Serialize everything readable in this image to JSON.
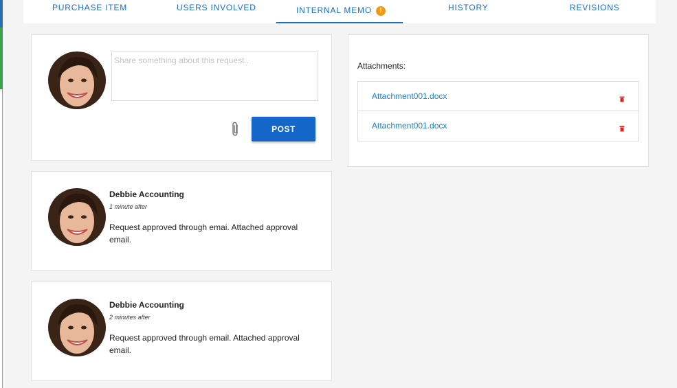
{
  "tabs": [
    {
      "label": "PURCHASE ITEM"
    },
    {
      "label": "USERS INVOLVED"
    },
    {
      "label": "INTERNAL MEMO",
      "badge": "!"
    },
    {
      "label": "HISTORY"
    },
    {
      "label": "REVISIONS"
    }
  ],
  "active_tab": "INTERNAL MEMO",
  "composer": {
    "placeholder": "Share something about this request..",
    "value": "",
    "post_label": "POST",
    "attach_icon": "paperclip-icon"
  },
  "comments": [
    {
      "author": "Debbie Accounting",
      "time": "1 minute after",
      "body": "Request approved through emai. Attached approval email."
    },
    {
      "author": "Debbie Accounting",
      "time": "2 minutes after",
      "body": "Request approved through email. Attached approval email."
    }
  ],
  "attachments": {
    "title": "Attachments:",
    "items": [
      {
        "name": "Attachment001.docx",
        "icon": "trash-icon"
      },
      {
        "name": "Attachment001.docx",
        "icon": "trash-icon"
      }
    ]
  },
  "colors": {
    "accent": "#1a6fbf",
    "button": "#1466c8",
    "badge": "#f29a16",
    "link": "#1a7fc8",
    "delete": "#e02424"
  }
}
